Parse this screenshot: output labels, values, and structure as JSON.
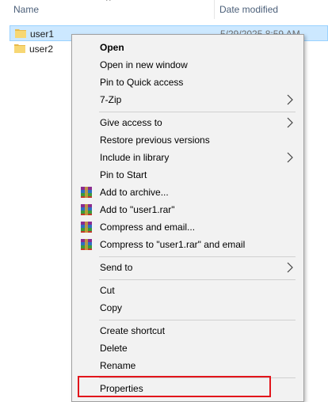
{
  "header": {
    "name_label": "Name",
    "sort_glyph": "^",
    "date_label": "Date modified"
  },
  "files": [
    {
      "name": "user1",
      "date": "5/29/2025 8:59 AM",
      "selected": true,
      "icon": "folder-icon"
    },
    {
      "name": "user2",
      "date": "",
      "selected": false,
      "icon": "folder-icon"
    }
  ],
  "menu": {
    "open": "Open",
    "open_new_window": "Open in new window",
    "pin_quick_access": "Pin to Quick access",
    "seven_zip": "7-Zip",
    "give_access": "Give access to",
    "restore_versions": "Restore previous versions",
    "include_library": "Include in library",
    "pin_start": "Pin to Start",
    "add_archive": "Add to archive...",
    "add_to_rar": "Add to \"user1.rar\"",
    "compress_email": "Compress and email...",
    "compress_rar_email": "Compress to \"user1.rar\" and email",
    "send_to": "Send to",
    "cut": "Cut",
    "copy": "Copy",
    "create_shortcut": "Create shortcut",
    "delete": "Delete",
    "rename": "Rename",
    "properties": "Properties"
  },
  "colors": {
    "selection_bg": "#cce8ff",
    "menu_bg": "#f2f2f2",
    "highlight_box": "#e2151b"
  }
}
